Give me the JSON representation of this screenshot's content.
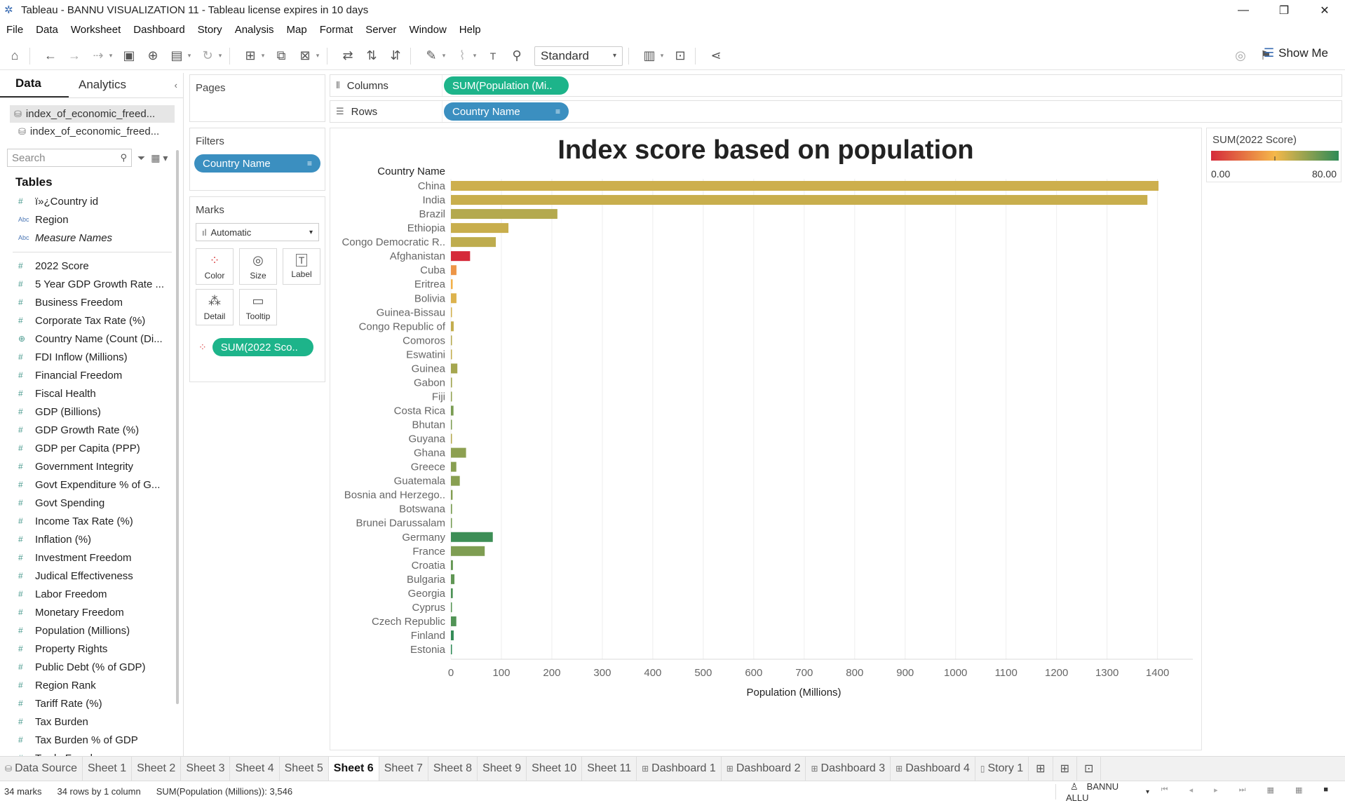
{
  "window": {
    "title": "Tableau - BANNU VISUALIZATION 11 - Tableau license expires in 10 days",
    "controls": [
      "—",
      "❐",
      "✕"
    ]
  },
  "menu": [
    "File",
    "Data",
    "Worksheet",
    "Dashboard",
    "Story",
    "Analysis",
    "Map",
    "Format",
    "Server",
    "Window",
    "Help"
  ],
  "toolbar": {
    "fit_select": "Standard",
    "show_me": "Show Me"
  },
  "left_pane": {
    "tabs": [
      "Data",
      "Analytics"
    ],
    "datasources": [
      "index_of_economic_freed...",
      "index_of_economic_freed..."
    ],
    "search_placeholder": "Search",
    "tables_heading": "Tables",
    "dimension_fields": [
      {
        "type": "#",
        "name": "ï»¿Country id"
      },
      {
        "type": "Abc",
        "name": "Region"
      },
      {
        "type": "Abc",
        "name": "Measure Names"
      }
    ],
    "measure_fields": [
      {
        "type": "#",
        "name": "2022 Score"
      },
      {
        "type": "#",
        "name": "5 Year GDP Growth Rate ..."
      },
      {
        "type": "#",
        "name": "Business Freedom"
      },
      {
        "type": "#",
        "name": "Corporate Tax Rate (%)"
      },
      {
        "type": "⊕",
        "name": "Country Name (Count (Di..."
      },
      {
        "type": "#",
        "name": "FDI Inflow (Millions)"
      },
      {
        "type": "#",
        "name": "Financial Freedom"
      },
      {
        "type": "#",
        "name": "Fiscal Health"
      },
      {
        "type": "#",
        "name": "GDP (Billions)"
      },
      {
        "type": "#",
        "name": "GDP Growth Rate (%)"
      },
      {
        "type": "#",
        "name": "GDP per Capita (PPP)"
      },
      {
        "type": "#",
        "name": "Government Integrity"
      },
      {
        "type": "#",
        "name": "Govt Expenditure % of G..."
      },
      {
        "type": "#",
        "name": "Govt Spending"
      },
      {
        "type": "#",
        "name": "Income Tax Rate (%)"
      },
      {
        "type": "#",
        "name": "Inflation (%)"
      },
      {
        "type": "#",
        "name": "Investment Freedom"
      },
      {
        "type": "#",
        "name": "Judical Effectiveness"
      },
      {
        "type": "#",
        "name": "Labor Freedom"
      },
      {
        "type": "#",
        "name": "Monetary Freedom"
      },
      {
        "type": "#",
        "name": "Population (Millions)"
      },
      {
        "type": "#",
        "name": "Property Rights"
      },
      {
        "type": "#",
        "name": "Public Debt (% of GDP)"
      },
      {
        "type": "#",
        "name": "Region Rank"
      },
      {
        "type": "#",
        "name": "Tariff Rate (%)"
      },
      {
        "type": "#",
        "name": "Tax Burden"
      },
      {
        "type": "#",
        "name": "Tax Burden % of GDP"
      },
      {
        "type": "#",
        "name": "Trade Freedom"
      }
    ]
  },
  "cards": {
    "pages": "Pages",
    "filters": "Filters",
    "filter_pill": "Country Name",
    "marks": "Marks",
    "marks_type": "Automatic",
    "mark_buttons": [
      "Color",
      "Size",
      "Label",
      "Detail",
      "Tooltip"
    ],
    "marks_pill": "SUM(2022 Sco.."
  },
  "shelves": {
    "columns_label": "Columns",
    "columns_pill": "SUM(Population (Mi..",
    "rows_label": "Rows",
    "rows_pill": "Country Name"
  },
  "legend": {
    "title": "SUM(2022 Score)",
    "min": "0.00",
    "max": "80.00"
  },
  "chart_data": {
    "type": "bar",
    "orientation": "horizontal",
    "title": "Index score based on population",
    "row_header": "Country Name",
    "xlabel": "Population (Millions)",
    "xlim": [
      0,
      1470
    ],
    "xticks": [
      0,
      100,
      200,
      300,
      400,
      500,
      600,
      700,
      800,
      900,
      1000,
      1100,
      1200,
      1300,
      1400
    ],
    "grid": true,
    "categories": [
      "China",
      "India",
      "Brazil",
      "Ethiopia",
      "Congo Democratic R..",
      "Afghanistan",
      "Cuba",
      "Eritrea",
      "Bolivia",
      "Guinea-Bissau",
      "Congo Republic of",
      "Comoros",
      "Eswatini",
      "Guinea",
      "Gabon",
      "Fiji",
      "Costa Rica",
      "Bhutan",
      "Guyana",
      "Ghana",
      "Greece",
      "Guatemala",
      "Bosnia and Herzego..",
      "Botswana",
      "Brunei Darussalam",
      "Germany",
      "France",
      "Croatia",
      "Bulgaria",
      "Georgia",
      "Cyprus",
      "Czech Republic",
      "Finland",
      "Estonia"
    ],
    "values": [
      1402,
      1380,
      211,
      114,
      89,
      38,
      11,
      3.5,
      11,
      1.9,
      5.5,
      0.9,
      1.2,
      12.8,
      2.2,
      0.9,
      5.1,
      0.8,
      0.8,
      30,
      10.7,
      17.6,
      3.3,
      2.3,
      0.4,
      83,
      67,
      4,
      7,
      3.7,
      1.2,
      10.7,
      5.5,
      1.3
    ],
    "color_values": [
      48,
      49,
      53,
      49,
      51,
      0,
      30,
      38,
      45,
      47,
      50,
      53,
      50,
      56,
      57,
      60,
      65,
      64,
      53,
      61,
      62,
      62,
      63,
      65,
      66,
      77,
      64,
      69,
      70,
      74,
      72,
      73,
      79,
      80
    ],
    "color_scale": {
      "min": 0,
      "max": 80,
      "low": "#d52a3a",
      "mid": "#f5b84a",
      "high": "#2e8b57"
    }
  },
  "sheet_tabs": [
    {
      "label": "Data Source",
      "icon": "⛁"
    },
    {
      "label": "Sheet 1"
    },
    {
      "label": "Sheet 2"
    },
    {
      "label": "Sheet 3"
    },
    {
      "label": "Sheet 4"
    },
    {
      "label": "Sheet 5"
    },
    {
      "label": "Sheet 6",
      "active": true
    },
    {
      "label": "Sheet 7"
    },
    {
      "label": "Sheet 8"
    },
    {
      "label": "Sheet 9"
    },
    {
      "label": "Sheet 10"
    },
    {
      "label": "Sheet 11"
    },
    {
      "label": "Dashboard 1",
      "icon": "⊞"
    },
    {
      "label": "Dashboard 2",
      "icon": "⊞"
    },
    {
      "label": "Dashboard 3",
      "icon": "⊞"
    },
    {
      "label": "Dashboard 4",
      "icon": "⊞"
    },
    {
      "label": "Story 1",
      "icon": "▯"
    }
  ],
  "status": {
    "marks": "34 marks",
    "rows_cols": "34 rows by 1 column",
    "sum": "SUM(Population (Millions)): 3,546",
    "user": "BANNU ALLU"
  }
}
